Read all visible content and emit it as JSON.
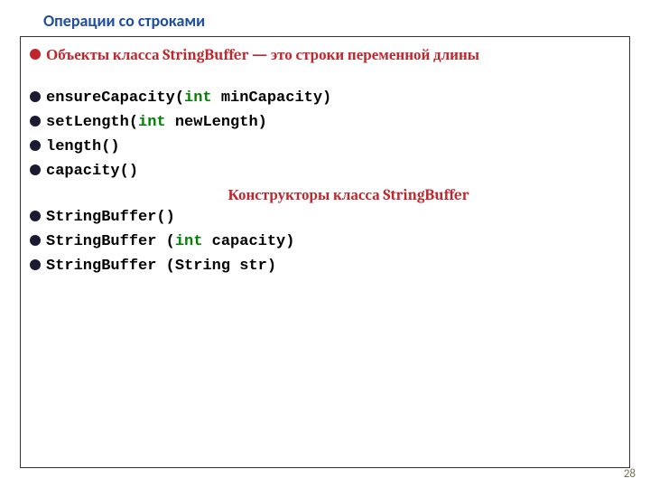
{
  "title": "Операции со строками",
  "intro": "Объекты класса StringBuffer — это строки переменной длины",
  "methods": [
    {
      "pre": "ensureCapacity(",
      "kw": "int",
      "post": " minCapacity)"
    },
    {
      "pre": " setLength(",
      "kw": "int",
      "post": " newLength)"
    },
    {
      "pre": " length()",
      "kw": "",
      "post": ""
    },
    {
      "pre": " capacity()",
      "kw": "",
      "post": ""
    }
  ],
  "subheading": "Конструкторы класса StringBuffer",
  "constructors": [
    {
      "pre": "StringBuffer()",
      "kw": "",
      "post": ""
    },
    {
      "pre": "StringBuffer (",
      "kw": "int",
      "post": " capacity)"
    },
    {
      "pre": "StringBuffer (String str)",
      "kw": "",
      "post": ""
    }
  ],
  "pageNumber": "28"
}
